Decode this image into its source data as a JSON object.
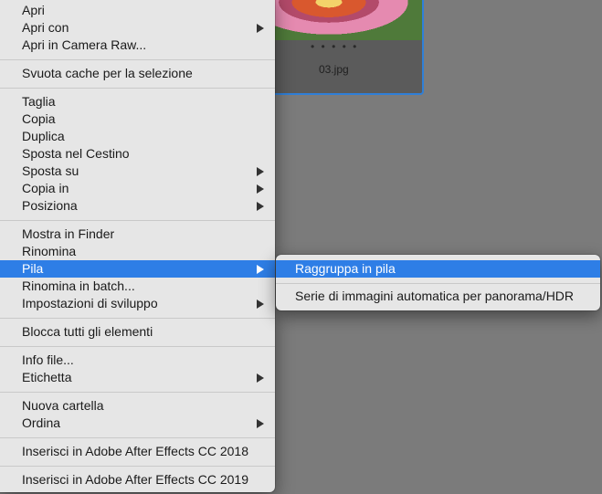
{
  "thumbnail": {
    "dots": "• • • • •",
    "filename": "03.jpg"
  },
  "menu": {
    "items": [
      {
        "label": "Apri",
        "submenu": false,
        "active": false
      },
      {
        "label": "Apri con",
        "submenu": true,
        "active": false
      },
      {
        "label": "Apri in Camera Raw...",
        "submenu": false,
        "active": false
      },
      {
        "label": "Svuota cache per la selezione",
        "submenu": false,
        "active": false
      },
      {
        "label": "Taglia",
        "submenu": false,
        "active": false
      },
      {
        "label": "Copia",
        "submenu": false,
        "active": false
      },
      {
        "label": "Duplica",
        "submenu": false,
        "active": false
      },
      {
        "label": "Sposta nel Cestino",
        "submenu": false,
        "active": false
      },
      {
        "label": "Sposta su",
        "submenu": true,
        "active": false
      },
      {
        "label": "Copia in",
        "submenu": true,
        "active": false
      },
      {
        "label": "Posiziona",
        "submenu": true,
        "active": false
      },
      {
        "label": "Mostra in Finder",
        "submenu": false,
        "active": false
      },
      {
        "label": "Rinomina",
        "submenu": false,
        "active": false
      },
      {
        "label": "Pila",
        "submenu": true,
        "active": true
      },
      {
        "label": "Rinomina in batch...",
        "submenu": false,
        "active": false
      },
      {
        "label": "Impostazioni di sviluppo",
        "submenu": true,
        "active": false
      },
      {
        "label": "Blocca tutti gli elementi",
        "submenu": false,
        "active": false
      },
      {
        "label": "Info file...",
        "submenu": false,
        "active": false
      },
      {
        "label": "Etichetta",
        "submenu": true,
        "active": false
      },
      {
        "label": "Nuova cartella",
        "submenu": false,
        "active": false
      },
      {
        "label": "Ordina",
        "submenu": true,
        "active": false
      },
      {
        "label": "Inserisci in Adobe After Effects CC 2018",
        "submenu": false,
        "active": false
      },
      {
        "label": "Inserisci in Adobe After Effects CC 2019",
        "submenu": false,
        "active": false
      }
    ]
  },
  "submenu": {
    "items": [
      {
        "label": "Raggruppa in pila",
        "active": true
      },
      {
        "label": "Serie di immagini automatica per panorama/HDR",
        "active": false
      }
    ]
  },
  "colors": {
    "highlight": "#2e7ee6",
    "menu_bg": "#e6e6e6",
    "desktop_bg": "#7b7b7b",
    "selection_border": "#2f7fd8"
  }
}
